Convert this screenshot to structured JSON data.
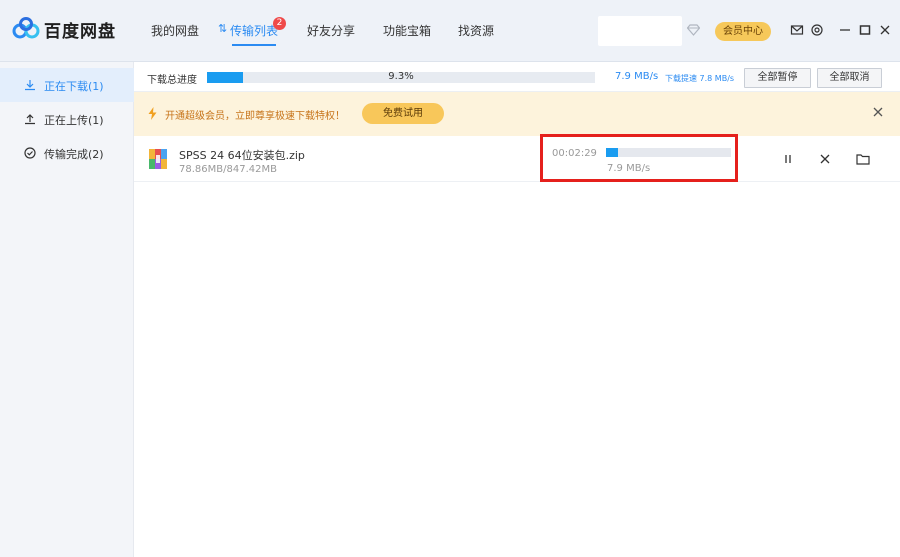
{
  "app": {
    "brand": "百度网盘",
    "colors": {
      "accent": "#2b8bf2",
      "vip": "#f6c85a",
      "banner_bg": "#fdf3dc",
      "highlight": "#e5201c"
    }
  },
  "nav": {
    "tabs": [
      {
        "label": "我的网盘"
      },
      {
        "label": "传输列表",
        "badge": "2",
        "active": true
      },
      {
        "label": "好友分享"
      },
      {
        "label": "功能宝箱"
      },
      {
        "label": "找资源"
      }
    ],
    "vip_label": "会员中心",
    "icons": [
      "diamond-icon",
      "mail-icon",
      "settings-icon",
      "minimize-icon",
      "maximize-icon",
      "close-icon"
    ]
  },
  "sidebar": {
    "items": [
      {
        "label": "正在下载(1)",
        "icon": "download-icon",
        "active": true
      },
      {
        "label": "正在上传(1)",
        "icon": "upload-icon"
      },
      {
        "label": "传输完成(2)",
        "icon": "check-circle-icon"
      }
    ]
  },
  "overall": {
    "label": "下载总进度",
    "percent_text": "9.3%",
    "percent": 9.3,
    "speed": "7.9 MB/s",
    "speed_limit": "下载提速 7.8 MB/s",
    "pause_all": "全部暂停",
    "cancel_all": "全部取消"
  },
  "banner": {
    "text": "开通超级会员，立即尊享极速下载特权！",
    "trial_label": "免费试用"
  },
  "download": {
    "name": "SPSS 24 64位安装包.zip",
    "size": "78.86MB/847.42MB",
    "time_left": "00:02:29",
    "progress": 9.3,
    "speed": "7.9 MB/s"
  }
}
